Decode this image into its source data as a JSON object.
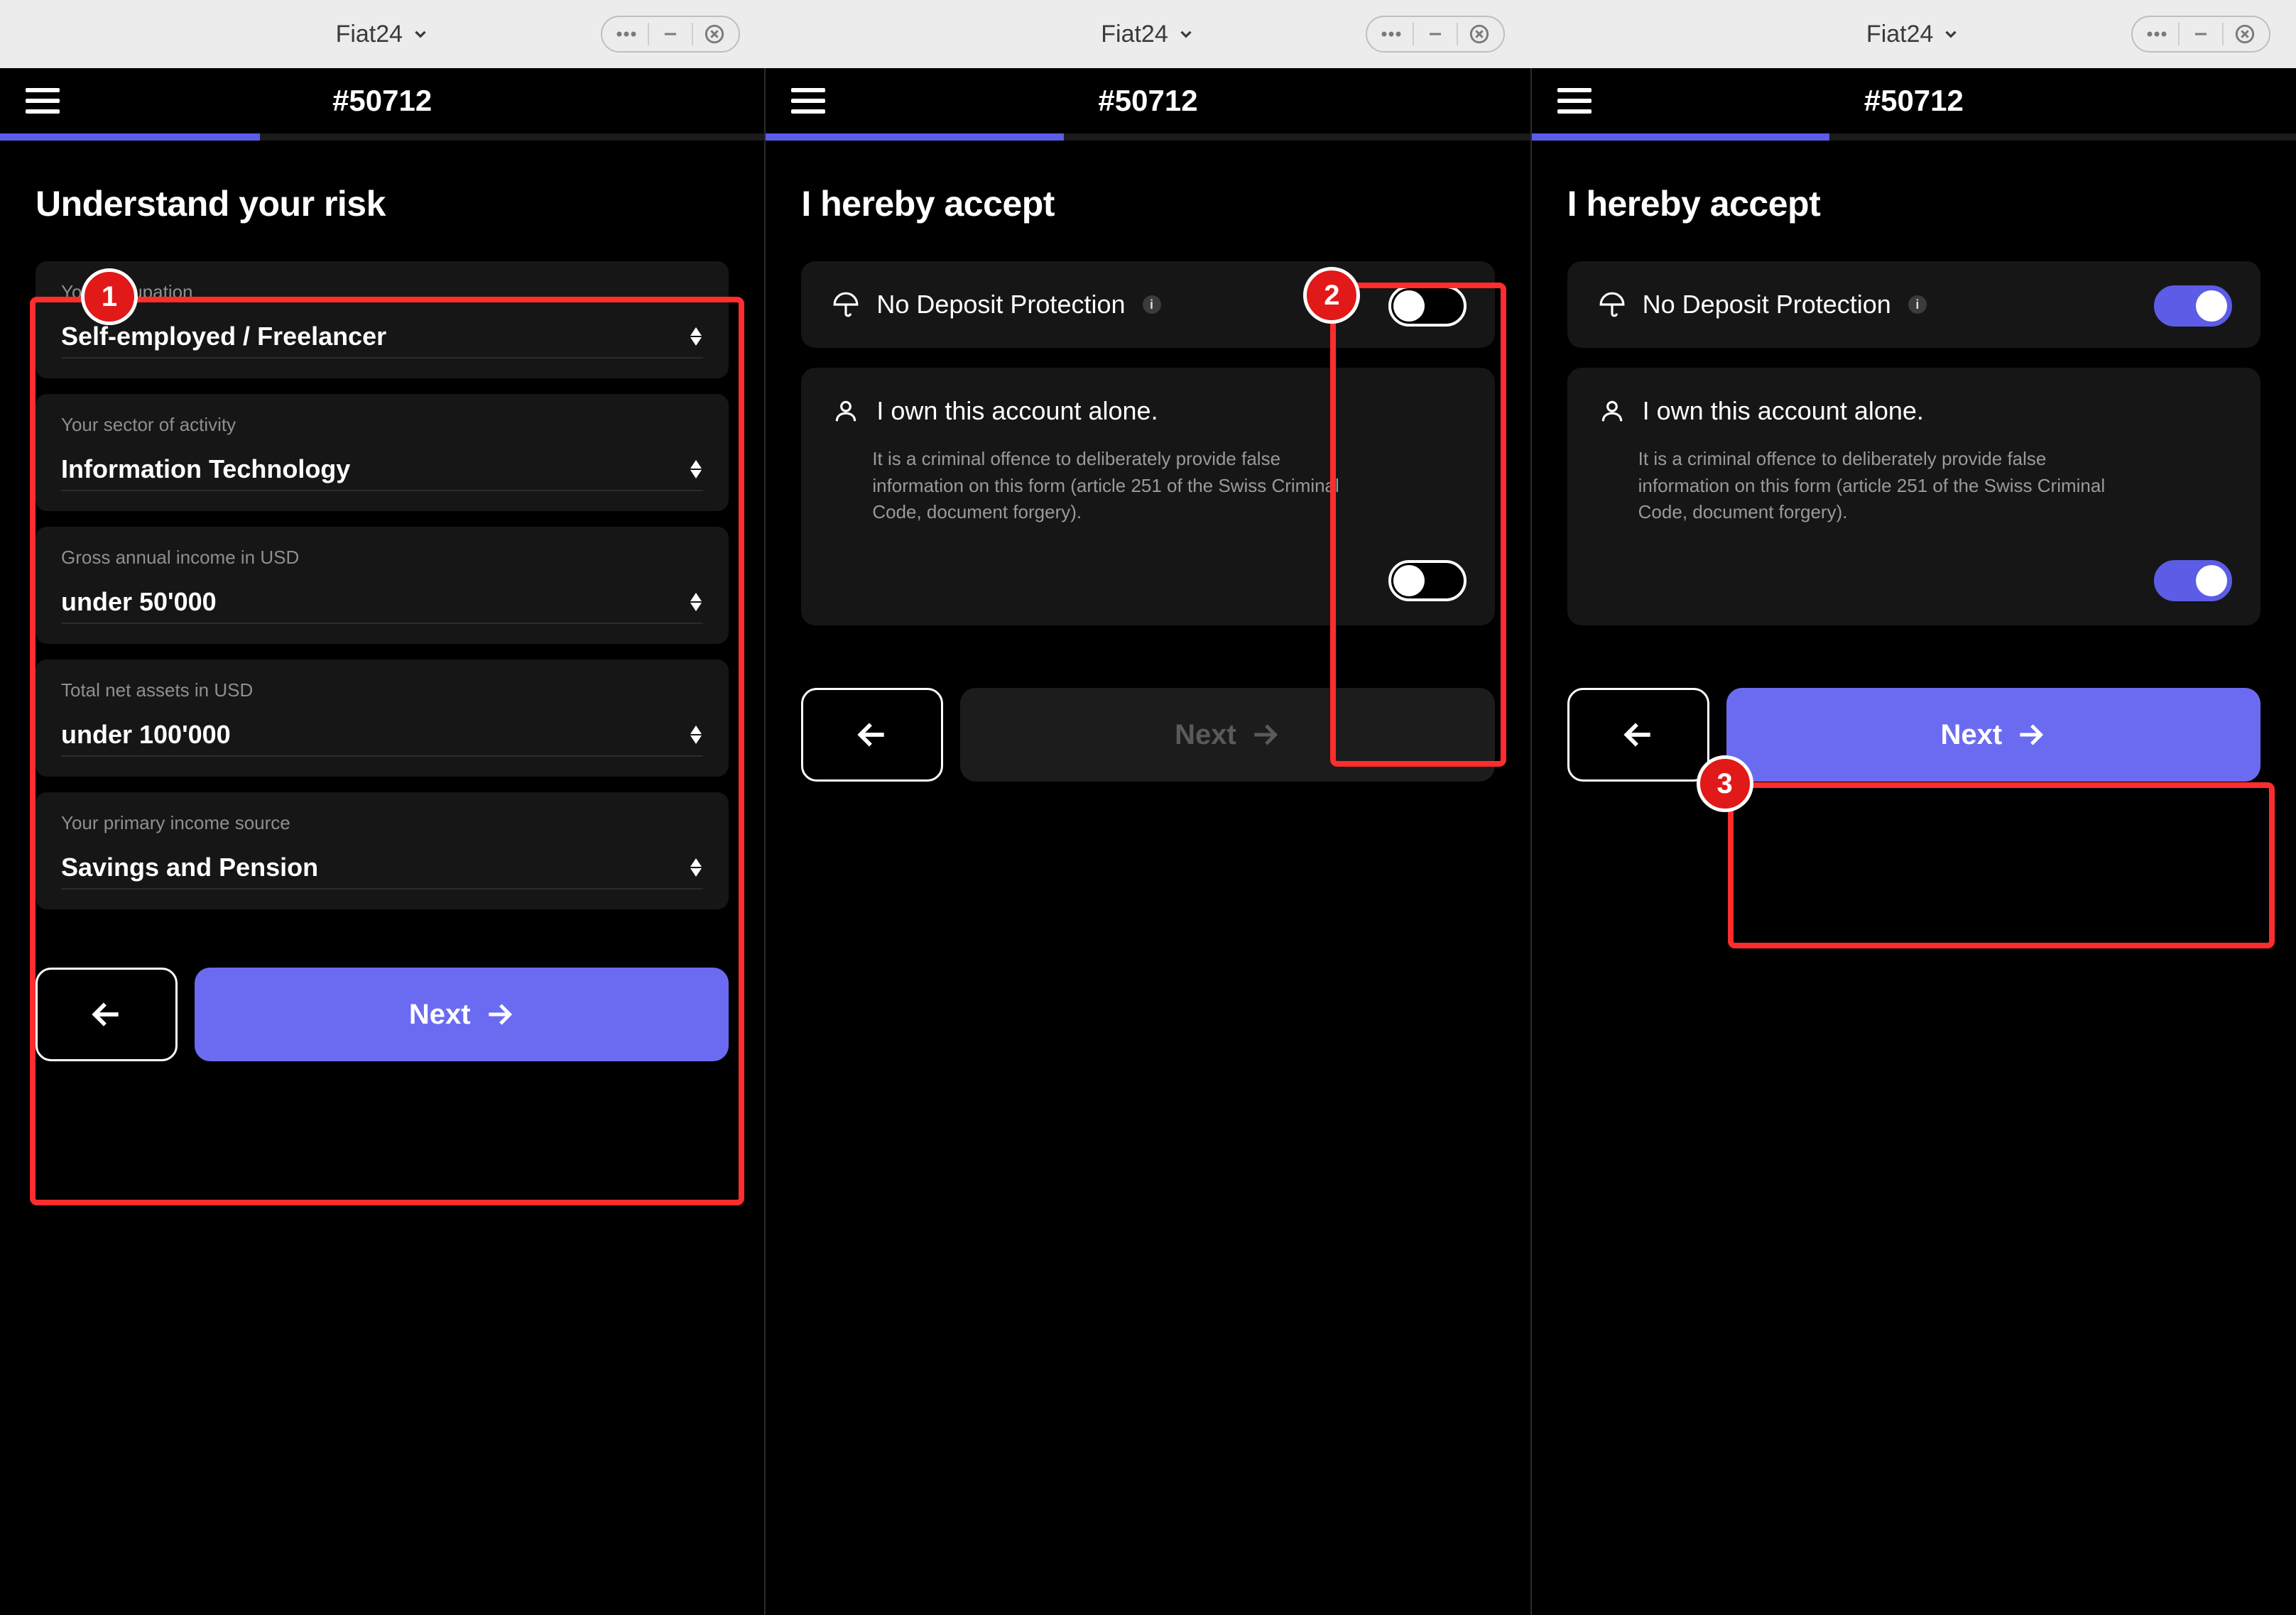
{
  "topbar": {
    "app_name": "Fiat24"
  },
  "app": {
    "id_label": "#50712"
  },
  "pane1": {
    "progress_pct": 34,
    "title": "Understand your risk",
    "fields": [
      {
        "label": "Your occupation",
        "value": "Self-employed / Freelancer"
      },
      {
        "label": "Your sector of activity",
        "value": "Information Technology"
      },
      {
        "label": "Gross annual income in USD",
        "value": "under 50'000"
      },
      {
        "label": "Total net assets in USD",
        "value": "under 100'000"
      },
      {
        "label": "Your primary income source",
        "value": "Savings and Pension"
      }
    ],
    "next_label": "Next",
    "callout": "1"
  },
  "pane2": {
    "progress_pct": 39,
    "title": "I hereby accept",
    "items": [
      {
        "title": "No Deposit Protection",
        "show_info": true,
        "toggle_on": false
      },
      {
        "title": "I own this account alone.",
        "subtitle": "It is a criminal offence to deliberately provide false information on this form (article 251 of the Swiss Criminal Code, document forgery).",
        "toggle_on": false
      }
    ],
    "next_label": "Next",
    "next_enabled": false,
    "callout": "2"
  },
  "pane3": {
    "progress_pct": 39,
    "title": "I hereby accept",
    "items": [
      {
        "title": "No Deposit Protection",
        "show_info": true,
        "toggle_on": true
      },
      {
        "title": "I own this account alone.",
        "subtitle": "It is a criminal offence to deliberately provide false information on this form (article 251 of the Swiss Criminal Code, document forgery).",
        "toggle_on": true
      }
    ],
    "next_label": "Next",
    "next_enabled": true,
    "callout": "3"
  }
}
